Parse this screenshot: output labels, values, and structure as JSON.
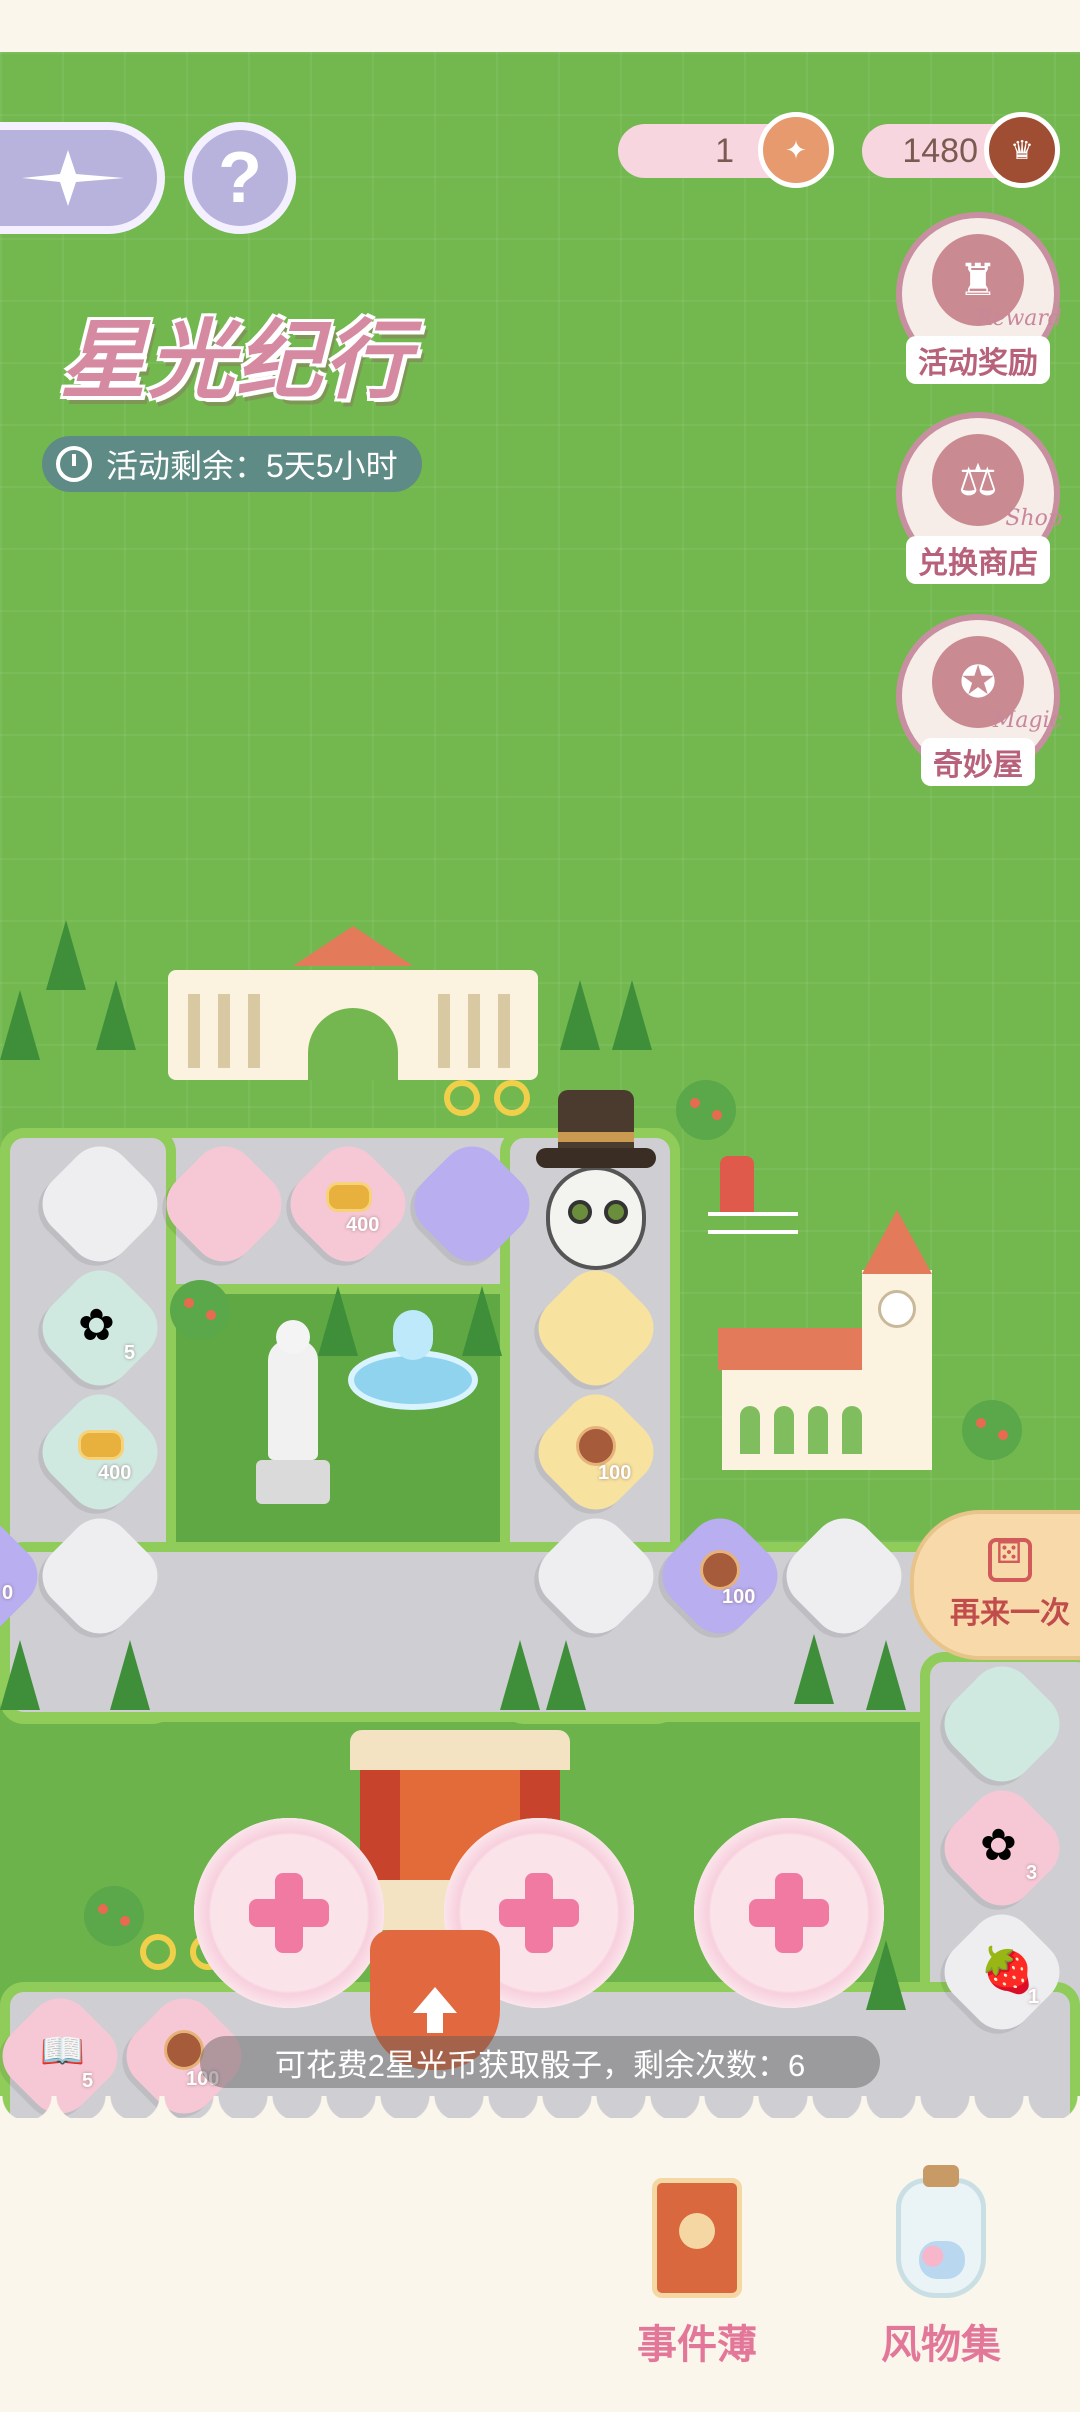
{
  "hud": {
    "back_icon": "sparkle-arrow-icon",
    "help_label": "?",
    "star_dice_count": "1",
    "star_coin_count": "1480"
  },
  "event": {
    "title": "星光纪行",
    "remaining_time": "活动剩余：5天5小时"
  },
  "side_menu": {
    "reward": {
      "label": "活动奖励",
      "tag": "Reward"
    },
    "shop": {
      "label": "兑换商店",
      "tag": "Shop"
    },
    "magic": {
      "label": "奇妙屋",
      "tag": "Magic"
    }
  },
  "board": {
    "redo_label": "再来一次",
    "tiles": {
      "gold_400_a": "400",
      "rainbow_5": "5",
      "gold_400_b": "400",
      "coin_100_yellow": "100",
      "coin_100_purple": "100",
      "edge_0": "0",
      "rainbow_3": "3",
      "gift_1": "1",
      "book_5": "5",
      "coin_100_bottom": "100"
    }
  },
  "dice_hint": "可花费2星光币获取骰子，剩余次数：6",
  "bottom_nav": [
    {
      "label": "事件薄",
      "icon": "book-icon"
    },
    {
      "label": "风物集",
      "icon": "jar-icon"
    }
  ]
}
